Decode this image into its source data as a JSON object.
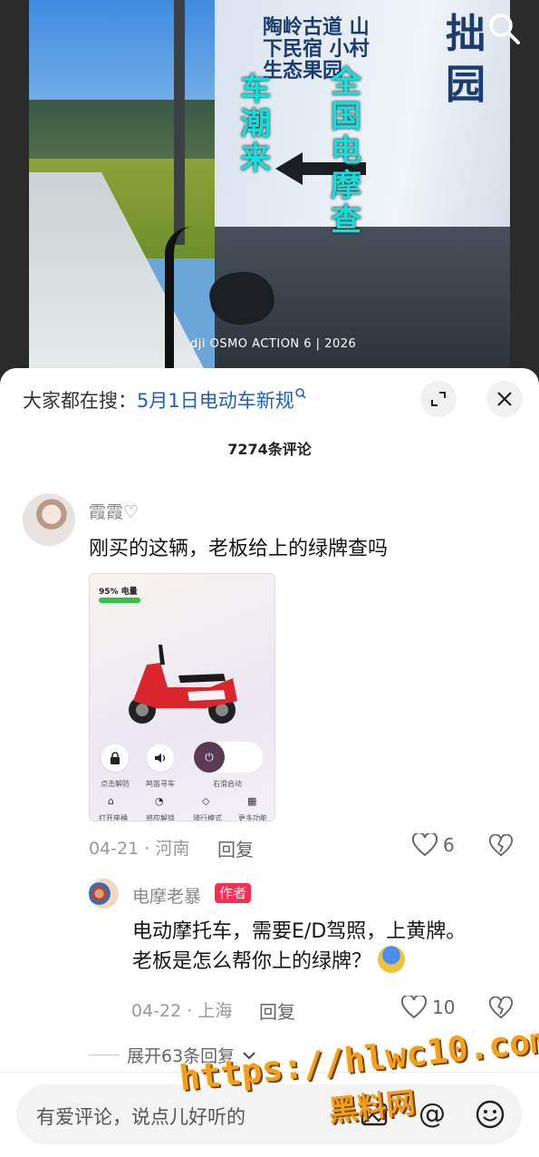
{
  "video": {
    "overlay_left": "车潮来",
    "overlay_right": "全国电摩查",
    "wall_text_small": "陶岭古道 山下民宿 小村 生态果园",
    "wall_text_large": "拙园",
    "brand_text": "dji OSMO ACTION 6 | 2026",
    "search_icon": "search-icon"
  },
  "sheet": {
    "suggest_prefix": "大家都在搜：",
    "suggest_query": "5月1日电动车新规",
    "count_label": "7274条评论"
  },
  "comments": [
    {
      "user": "霞霞♡",
      "text": "刚买的这辆，老板给上的绿牌查吗",
      "meta": "04-21 · 河南",
      "reply_label": "回复",
      "likes": "6",
      "image": {
        "battery_label": "95% 电量",
        "battery_level": 0.95,
        "buttons": [
          "点击解防",
          "鸣笛寻车",
          "右滑启动"
        ],
        "bottom_row": [
          "打开座桶",
          "感应解锁",
          "骑行模式",
          "更多功能"
        ]
      }
    },
    {
      "user": "电摩老暴",
      "author_tag": "作者",
      "text_line1": "电动摩托车，需要E/D驾照，上黄牌。",
      "text_line2": "老板是怎么帮你上的绿牌？",
      "meta": "04-22 · 上海",
      "reply_label": "回复",
      "likes": "10"
    }
  ],
  "more_replies": "展开63条回复",
  "input": {
    "placeholder": "有爱评论，说点儿好听的"
  },
  "watermark": {
    "url": "https://hlwc10.com",
    "name": "黑料网"
  },
  "colors": {
    "accent": "#fe2c55",
    "link": "#1f5fbf",
    "overlay_text": "#12e0dc",
    "watermark": "#f2a01c"
  }
}
